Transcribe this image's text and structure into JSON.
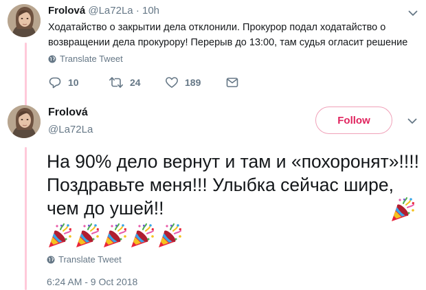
{
  "tweets": [
    {
      "display_name": "Frolová",
      "handle": "@La72La",
      "separator": "·",
      "time_ago": "10h",
      "text": "Ходатайство о закрытии дела отклонили. Прокурор подал ходатайство о возвращении дела прокурору! Перерыв до 13:00, там судья огласит решение",
      "translate_label": "Translate Tweet",
      "actions": {
        "reply_count": "10",
        "retweet_count": "24",
        "like_count": "189"
      },
      "icons": [
        "avatar",
        "chevron-down-icon",
        "globe-icon",
        "reply-icon",
        "retweet-icon",
        "like-icon",
        "direct-message-icon"
      ]
    },
    {
      "display_name": "Frolová",
      "handle": "@La72La",
      "follow_label": "Follow",
      "text": "На 90% дело вернут и там и «похоронят»!!!! Поздравьте меня!!! Улыбка сейчас шире, чем до ушей!!",
      "emoji_count_inline": 1,
      "emoji_count_row": 5,
      "emoji_name": "party-popper",
      "translate_label": "Translate Tweet",
      "timestamp": "6:24 AM - 9 Oct 2018",
      "icons": [
        "avatar",
        "chevron-down-icon",
        "globe-icon",
        "party-popper-icon"
      ]
    }
  ],
  "colors": {
    "thread_line": "#ffc9da",
    "follow_accent": "#e0245e",
    "muted_text": "#657786",
    "primary_text": "#14171a"
  }
}
